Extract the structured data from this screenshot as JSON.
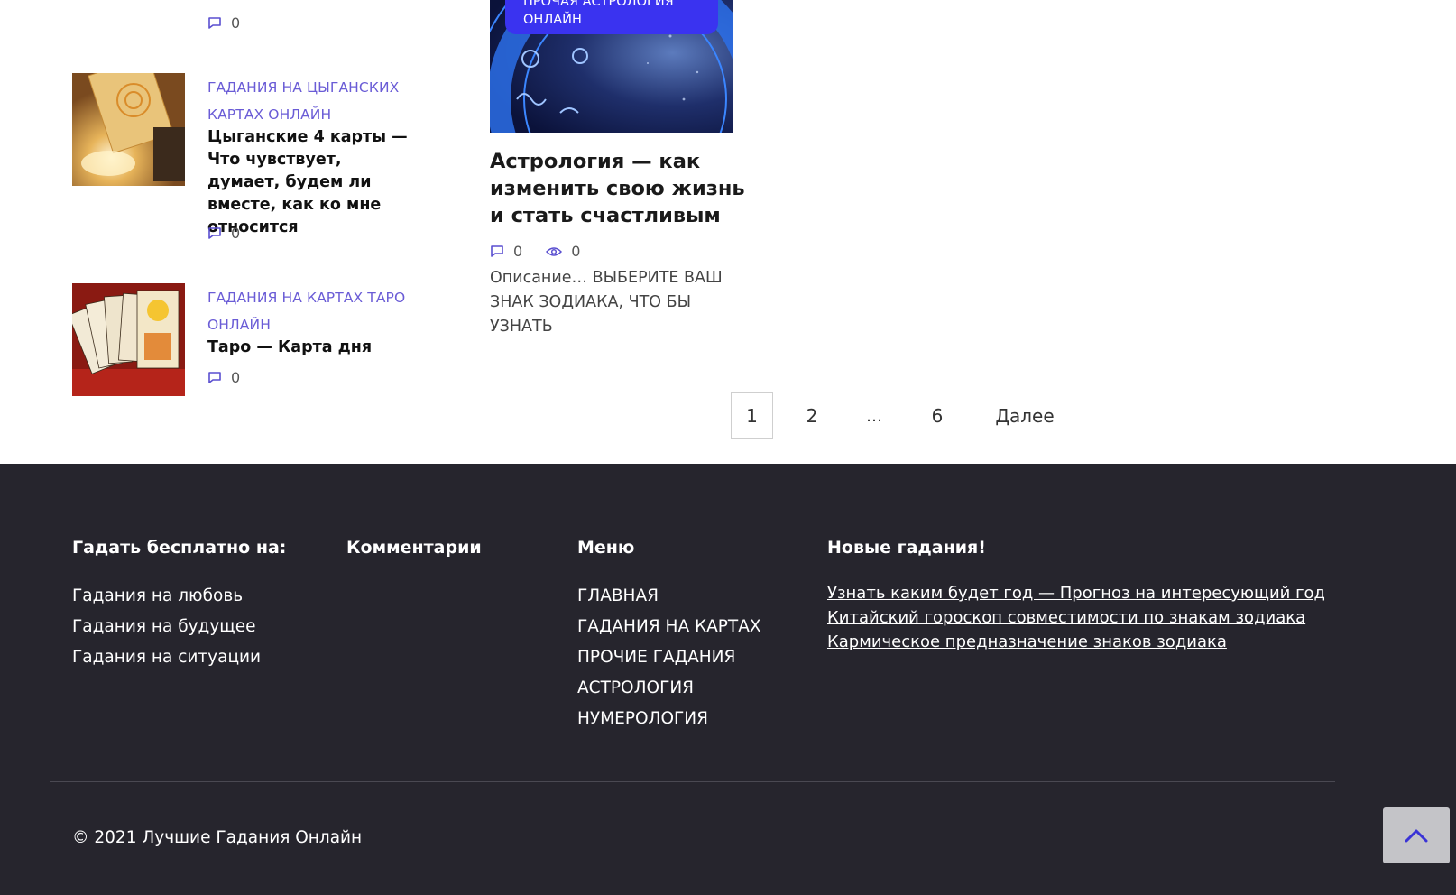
{
  "sidebar_posts": [
    {
      "category": "",
      "title": "",
      "comments": "0"
    },
    {
      "category": "ГАДАНИЯ НА ЦЫГАНСКИХ КАРТАХ ОНЛАЙН",
      "title": "Цыганские 4 карты — Что чувствует, думает, будем ли вместе, как ко мне относится",
      "comments": "0"
    },
    {
      "category": "ГАДАНИЯ НА КАРТАХ ТАРО ОНЛАЙН",
      "title": "Таро — Карта дня",
      "comments": "0"
    }
  ],
  "featured_post": {
    "badge": "ПРОЧАЯ АСТРОЛОГИЯ ОНЛАЙН",
    "title": "Астрология — как изменить свою жизнь и стать счастливым",
    "comments": "0",
    "views": "0",
    "description": "Описание… ВЫБЕРИТЕ ВАШ ЗНАК ЗОДИАКА, ЧТО БЫ УЗНАТЬ"
  },
  "pagination": {
    "pages": [
      "1",
      "2",
      "…",
      "6"
    ],
    "next": "Далее"
  },
  "footer": {
    "col1": {
      "heading": "Гадать бесплатно на:",
      "items": [
        "Гадания на любовь",
        "Гадания на будущее",
        "Гадания на ситуации"
      ]
    },
    "col2": {
      "heading": "Комментарии"
    },
    "col3": {
      "heading": "Меню",
      "items": [
        "ГЛАВНАЯ",
        "ГАДАНИЯ НА КАРТАХ",
        "ПРОЧИЕ ГАДАНИЯ",
        "АСТРОЛОГИЯ",
        "НУМЕРОЛОГИЯ"
      ]
    },
    "col4": {
      "heading": "Новые гадания!",
      "links": [
        "Узнать каким будет год — Прогноз на интересующий год",
        "Китайский гороскоп совместимости по знакам зодиака",
        "Кармическое предназначение знаков зодиака"
      ]
    },
    "copyright": "© 2021 Лучшие Гадания Онлайн"
  },
  "colors": {
    "accent": "#6a5cd6",
    "badge": "#3a33f0",
    "footer_bg": "#26252d"
  },
  "icons": [
    "comment-icon",
    "eye-icon",
    "chevron-up-icon"
  ]
}
